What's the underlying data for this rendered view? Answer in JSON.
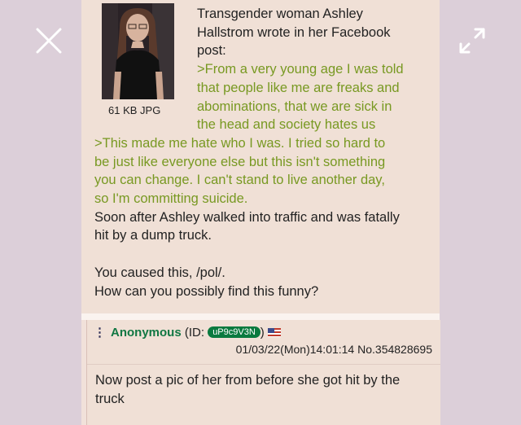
{
  "viewer": {
    "close_icon": "close-icon",
    "expand_icon": "expand-icon"
  },
  "post": {
    "file_info": "61 KB JPG",
    "lines": [
      {
        "text": "Transgender woman Ashley",
        "green": false
      },
      {
        "text": "Hallstrom wrote in her Facebook",
        "green": false
      },
      {
        "text": "post:",
        "green": false
      },
      {
        "text": ">From a very young age I was told",
        "green": true
      },
      {
        "text": "that people like me are freaks and",
        "green": true
      },
      {
        "text": "abominations, that we are sick in",
        "green": true
      },
      {
        "text": "the head and society hates us",
        "green": true
      },
      {
        "text": ">This made me hate who I was. I tried so hard to",
        "green": true
      },
      {
        "text": "be just like everyone else but this isn't something",
        "green": true
      },
      {
        "text": "you can change. I can't stand to live another day,",
        "green": true
      },
      {
        "text": "so I'm committing suicide.",
        "green": true
      },
      {
        "text": "Soon after Ashley walked into traffic and was fatally",
        "green": false
      },
      {
        "text": "hit by a dump truck.",
        "green": false
      },
      {
        "text": "",
        "green": false
      },
      {
        "text": "You caused this, /pol/.",
        "green": false
      },
      {
        "text": "How can you possibly find this funny?",
        "green": false
      }
    ]
  },
  "reply": {
    "menu": "⋮",
    "name": "Anonymous",
    "id_prefix": "(ID:",
    "id": "uP9c9V3N",
    "id_suffix": ")",
    "date": "01/03/22(Mon)14:01:14",
    "number": "No.354828695",
    "text": "Now post a pic of her from before she got hit by the truck"
  },
  "colors": {
    "background": "#dccfd9",
    "post_bg": "#f0e0d6",
    "greentext": "#789922",
    "name": "#117743"
  }
}
